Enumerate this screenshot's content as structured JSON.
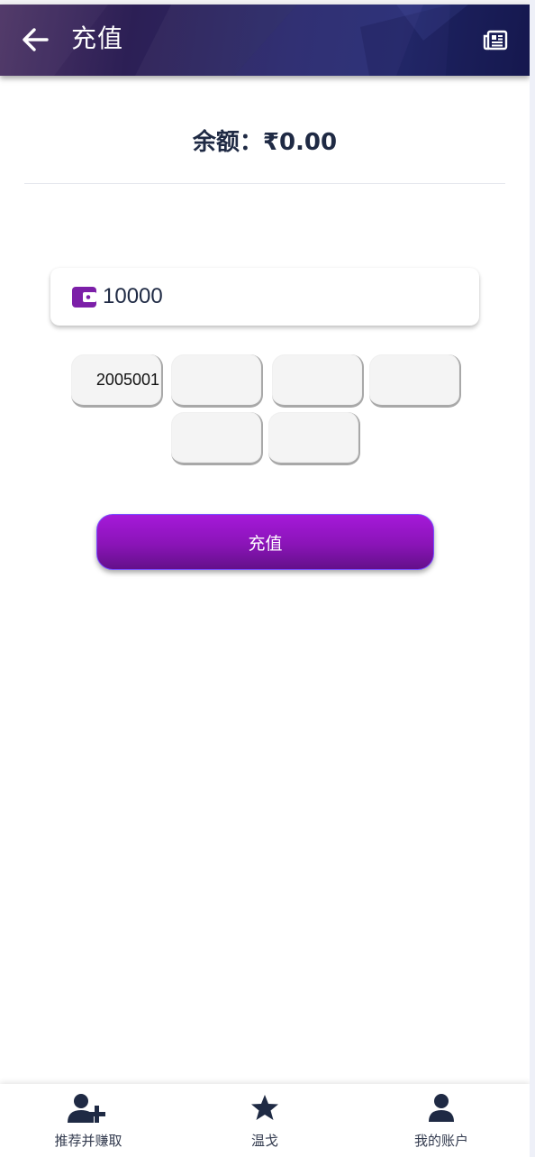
{
  "header": {
    "title": "充值",
    "back_icon": "arrow-left-icon",
    "news_icon": "newspaper-icon",
    "gradient_colors": [
      "#4e3566",
      "#2c1f55",
      "#272d72",
      "#1b1d57"
    ]
  },
  "balance": {
    "label": "余额：",
    "value": "₹0.00"
  },
  "amount": {
    "icon": "wallet-icon",
    "value": "10000",
    "icon_color": "#7c1fa8"
  },
  "quick_amounts": [
    {
      "label": "2005001"
    },
    {
      "label": ""
    },
    {
      "label": ""
    },
    {
      "label": ""
    },
    {
      "label": ""
    },
    {
      "label": ""
    }
  ],
  "recharge_button": {
    "label": "充值",
    "colors": [
      "#a519d9",
      "#64108a"
    ]
  },
  "bottom_nav": {
    "items": [
      {
        "label": "推荐并赚取",
        "icon": "user-plus-icon"
      },
      {
        "label": "温戈",
        "icon": "star-icon"
      },
      {
        "label": "我的账户",
        "icon": "user-icon"
      }
    ],
    "icon_color": "#1f2a44"
  }
}
